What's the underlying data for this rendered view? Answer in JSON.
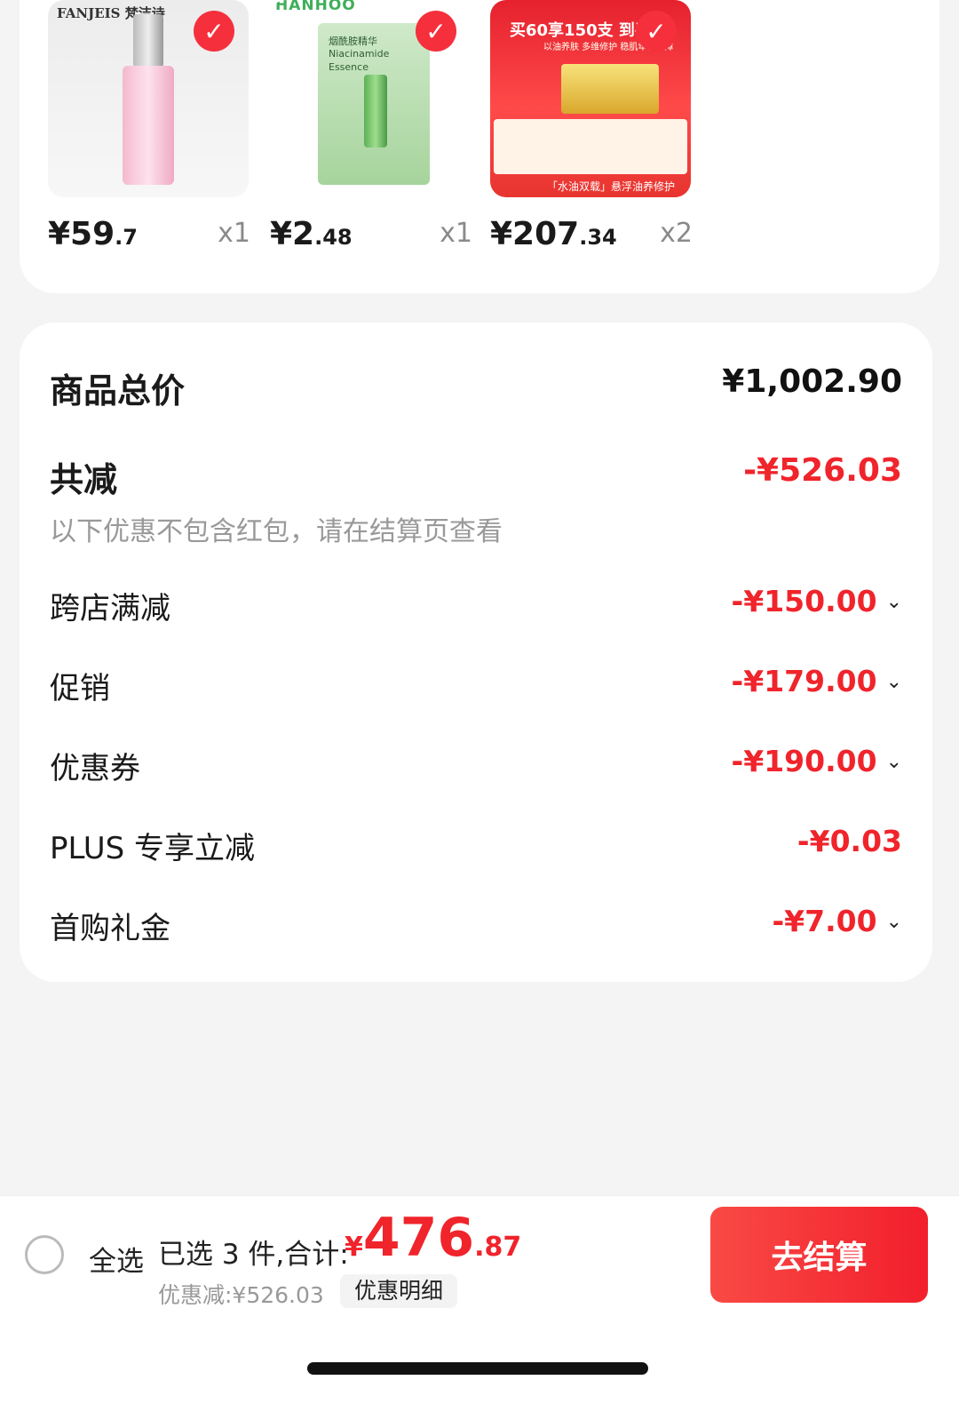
{
  "products": [
    {
      "brand": "FANJEIS 梵洁诗",
      "price_int": "¥59",
      "price_dec": ".7",
      "qty": "x1"
    },
    {
      "brand": "HANHOO",
      "mask_text": "烟酰胺精华 Niacinamide Essence",
      "price_int": "¥2",
      "price_dec": ".48",
      "qty": "x1"
    },
    {
      "promo_title": "买60享150支 到手5",
      "promo_sub": "以油养肤 多维修护 稳肌年轻屏障",
      "promo_foot": "「水油双载」悬浮油养修护",
      "price_int": "¥207",
      "price_dec": ".34",
      "qty": "x2"
    }
  ],
  "summary": {
    "total_label": "商品总价",
    "total_value": "¥1,002.90",
    "reduce_label": "共减",
    "reduce_value": "-¥526.03",
    "note": "以下优惠不包含红包，请在结算页查看",
    "discounts": [
      {
        "label": "跨店满减",
        "value": "-¥150.00",
        "has_chevron": true
      },
      {
        "label": "促销",
        "value": "-¥179.00",
        "has_chevron": true
      },
      {
        "label": "优惠券",
        "value": "-¥190.00",
        "has_chevron": true
      },
      {
        "label": "PLUS 专享立减",
        "value": "-¥0.03",
        "has_chevron": false
      },
      {
        "label": "首购礼金",
        "value": "-¥7.00",
        "has_chevron": true
      }
    ]
  },
  "bottom_bar": {
    "select_all": "全选",
    "selected_text": "已选 3 件,合计:",
    "total_yen": "¥",
    "total_int": "476",
    "total_dec": ".87",
    "discount_text": "优惠减:¥526.03",
    "detail_btn": "优惠明细",
    "checkout_btn": "去结算"
  },
  "colors": {
    "accent_red": "#f0242b",
    "background": "#f4f4f4"
  },
  "icons": {
    "check": "check-icon",
    "chevron": "chevron-down-icon"
  }
}
